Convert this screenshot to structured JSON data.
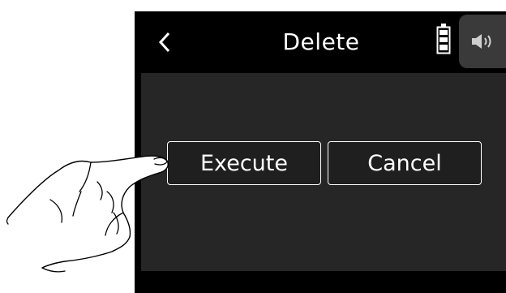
{
  "header": {
    "title": "Delete",
    "back_icon": "chevron-left-icon",
    "battery_icon": "battery-icon",
    "speaker_icon": "speaker-icon"
  },
  "dialog": {
    "execute_label": "Execute",
    "cancel_label": "Cancel"
  },
  "colors": {
    "screen_bg": "#000000",
    "content_bg": "#262626",
    "speaker_bg": "#3a3a3a",
    "text": "#ffffff"
  }
}
